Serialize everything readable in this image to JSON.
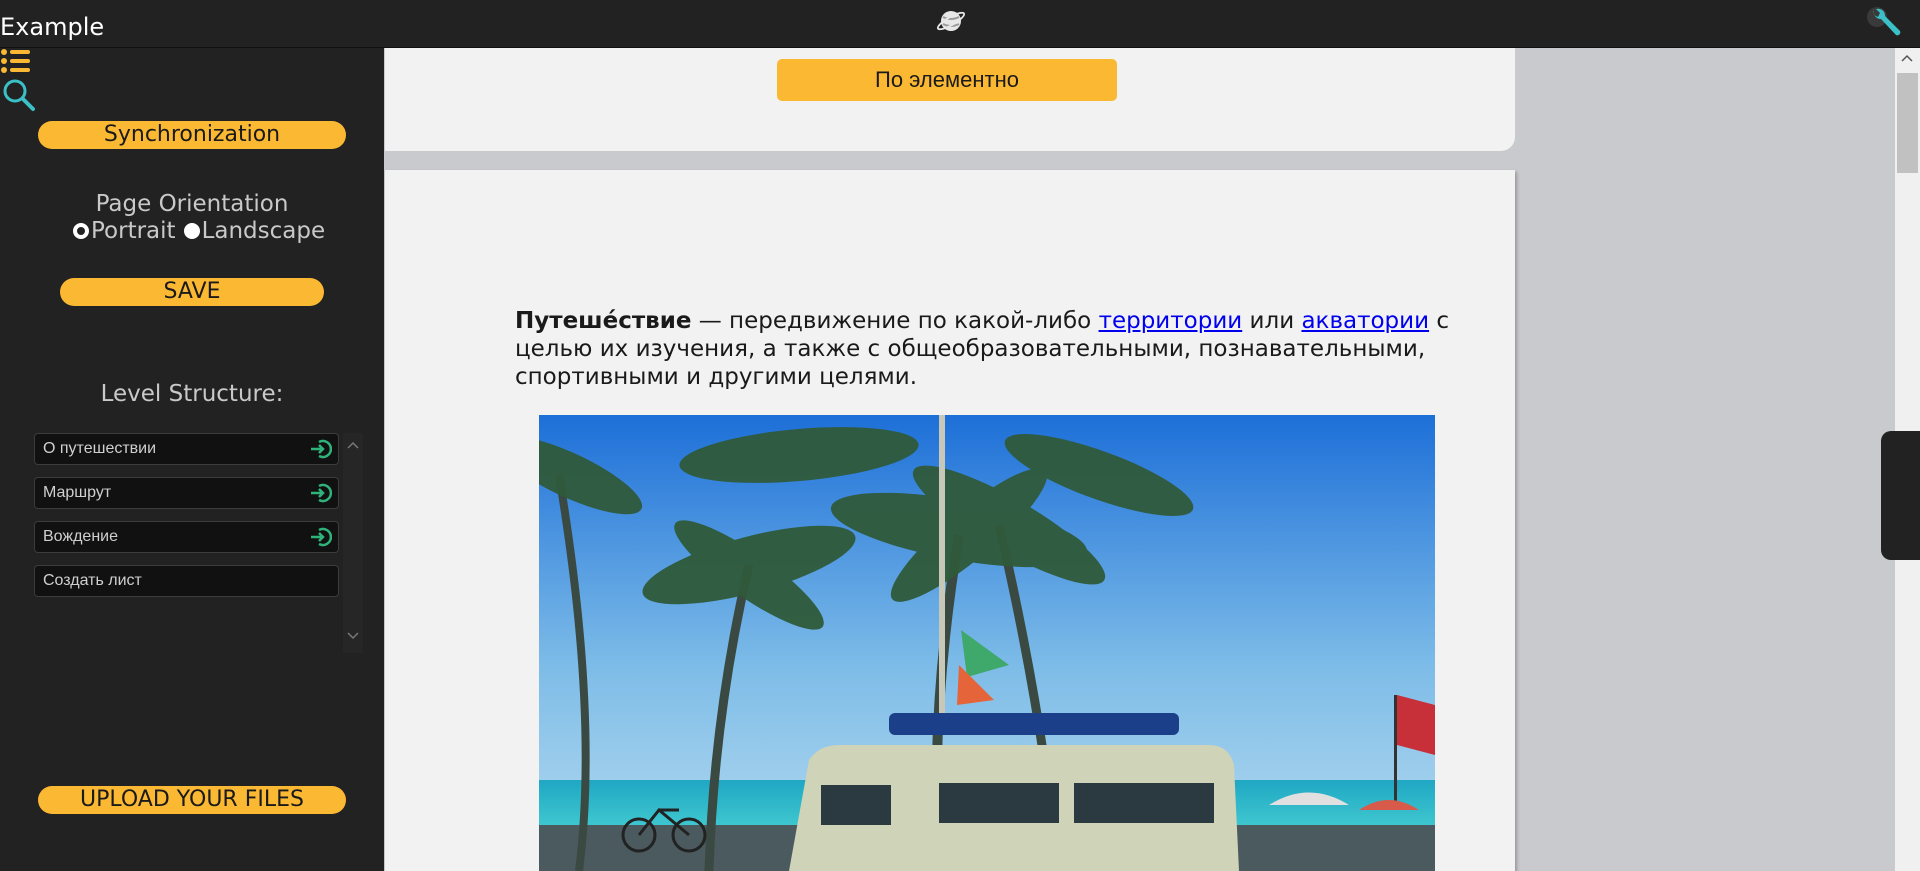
{
  "app": {
    "title": "Example"
  },
  "icons": {
    "menu": "list-icon",
    "search": "search-icon",
    "logo": "planet-icon",
    "settings": "wrench-icon",
    "enter": "enter-icon"
  },
  "sidebar": {
    "sync_label": "Synchronization",
    "orientation": {
      "title": "Page Orientation",
      "options": [
        {
          "label": "Portrait",
          "selected": true
        },
        {
          "label": "Landscape",
          "selected": false
        }
      ]
    },
    "save_label": "SAVE",
    "level_title": "Level Structure:",
    "levels": [
      {
        "label": "О путешествии",
        "has_enter": true
      },
      {
        "label": "Маршрут",
        "has_enter": true
      },
      {
        "label": "Вождение",
        "has_enter": true
      },
      {
        "label": "Создать лист",
        "has_enter": false
      }
    ],
    "upload_label": "UPLOAD YOUR FILES"
  },
  "main": {
    "mode_button": "По элементно",
    "paragraph": {
      "term": "Путеше́ствие",
      "part1": " — передвижение по какой-либо ",
      "link1": "территории",
      "part2": " или ",
      "link2": "акватории",
      "part3": " с целью их изучения, а также с общеобразовательными, познавательными, спортивными и другими целями."
    }
  },
  "colors": {
    "accent": "#fbb833",
    "sidebar_bg": "#222222",
    "doc_bg": "#f2f2f2",
    "workspace_bg": "#c8cacd",
    "icon_teal": "#3cc0c8",
    "enter_green": "#2fb37a"
  }
}
